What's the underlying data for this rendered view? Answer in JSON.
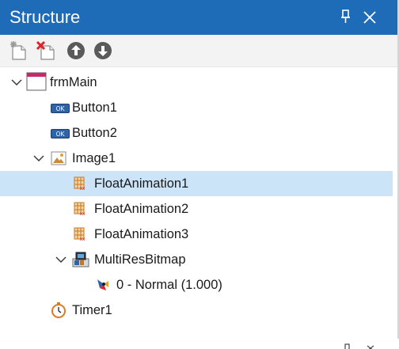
{
  "window": {
    "title": "Structure",
    "accent_color": "#1e6bb8",
    "selection_color": "#cce4f7",
    "pin_icon": "pin-icon",
    "close_icon": "close-icon"
  },
  "toolbar": {
    "buttons": [
      {
        "icon": "add-component-icon"
      },
      {
        "icon": "delete-component-icon"
      },
      {
        "icon": "move-up-icon"
      },
      {
        "icon": "move-down-icon"
      }
    ]
  },
  "tree": {
    "items": [
      {
        "label": "frmMain",
        "icon": "form-icon",
        "expanded": true
      },
      {
        "label": "Button1",
        "icon": "button-icon"
      },
      {
        "label": "Button2",
        "icon": "button-icon"
      },
      {
        "label": "Image1",
        "icon": "image-icon",
        "expanded": true
      },
      {
        "label": "FloatAnimation1",
        "icon": "float-animation-icon",
        "selected": true
      },
      {
        "label": "FloatAnimation2",
        "icon": "float-animation-icon"
      },
      {
        "label": "FloatAnimation3",
        "icon": "float-animation-icon"
      },
      {
        "label": "MultiResBitmap",
        "icon": "multires-bitmap-icon",
        "expanded": true
      },
      {
        "label": "0 - Normal (1.000)",
        "icon": "bitmap-item-icon"
      },
      {
        "label": "Timer1",
        "icon": "timer-icon"
      }
    ]
  }
}
